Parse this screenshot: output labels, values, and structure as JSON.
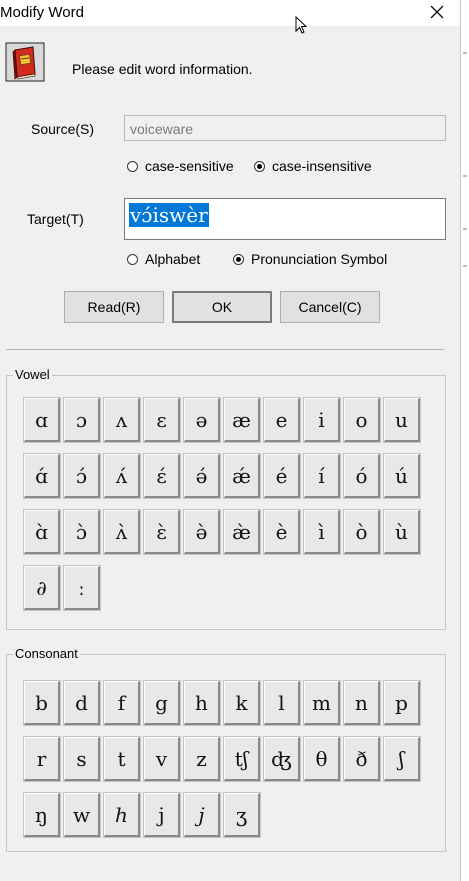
{
  "window": {
    "title": "Modify Word"
  },
  "header": {
    "info": "Please edit word information."
  },
  "source": {
    "label": "Source(S)",
    "value": "voiceware",
    "options": [
      {
        "label": "case-sensitive",
        "checked": false
      },
      {
        "label": "case-insensitive",
        "checked": true
      }
    ]
  },
  "target": {
    "label": "Target(T)",
    "value": "vɔ́iswèr",
    "options": [
      {
        "label": "Alphabet",
        "checked": false
      },
      {
        "label": "Pronunciation Symbol",
        "checked": true
      }
    ]
  },
  "buttons": {
    "read": "Read(R)",
    "ok": "OK",
    "cancel": "Cancel(C)"
  },
  "vowel": {
    "title": "Vowel",
    "keys": [
      "ɑ",
      "ɔ",
      "ʌ",
      "ɛ",
      "ə",
      "æ",
      "e",
      "i",
      "o",
      "u",
      "ɑ́",
      "ɔ́",
      "ʌ́",
      "ɛ́",
      "ə́",
      "ǽ",
      "é",
      "í",
      "ó",
      "ú",
      "ɑ̀",
      "ɔ̀",
      "ʌ̀",
      "ɛ̀",
      "ə̀",
      "æ̀",
      "è",
      "ì",
      "ò",
      "ù",
      "∂",
      "ː"
    ]
  },
  "consonant": {
    "title": "Consonant",
    "keys": [
      "b",
      "d",
      "f",
      "g",
      "h",
      "k",
      "l",
      "m",
      "n",
      "p",
      "r",
      "s",
      "t",
      "v",
      "z",
      "tʃ",
      "ʤ",
      "θ",
      "ð",
      "ʃ",
      "ŋ",
      "w",
      "h",
      "j",
      "j",
      "ʒ"
    ],
    "italic_indices": [
      22,
      24
    ]
  }
}
